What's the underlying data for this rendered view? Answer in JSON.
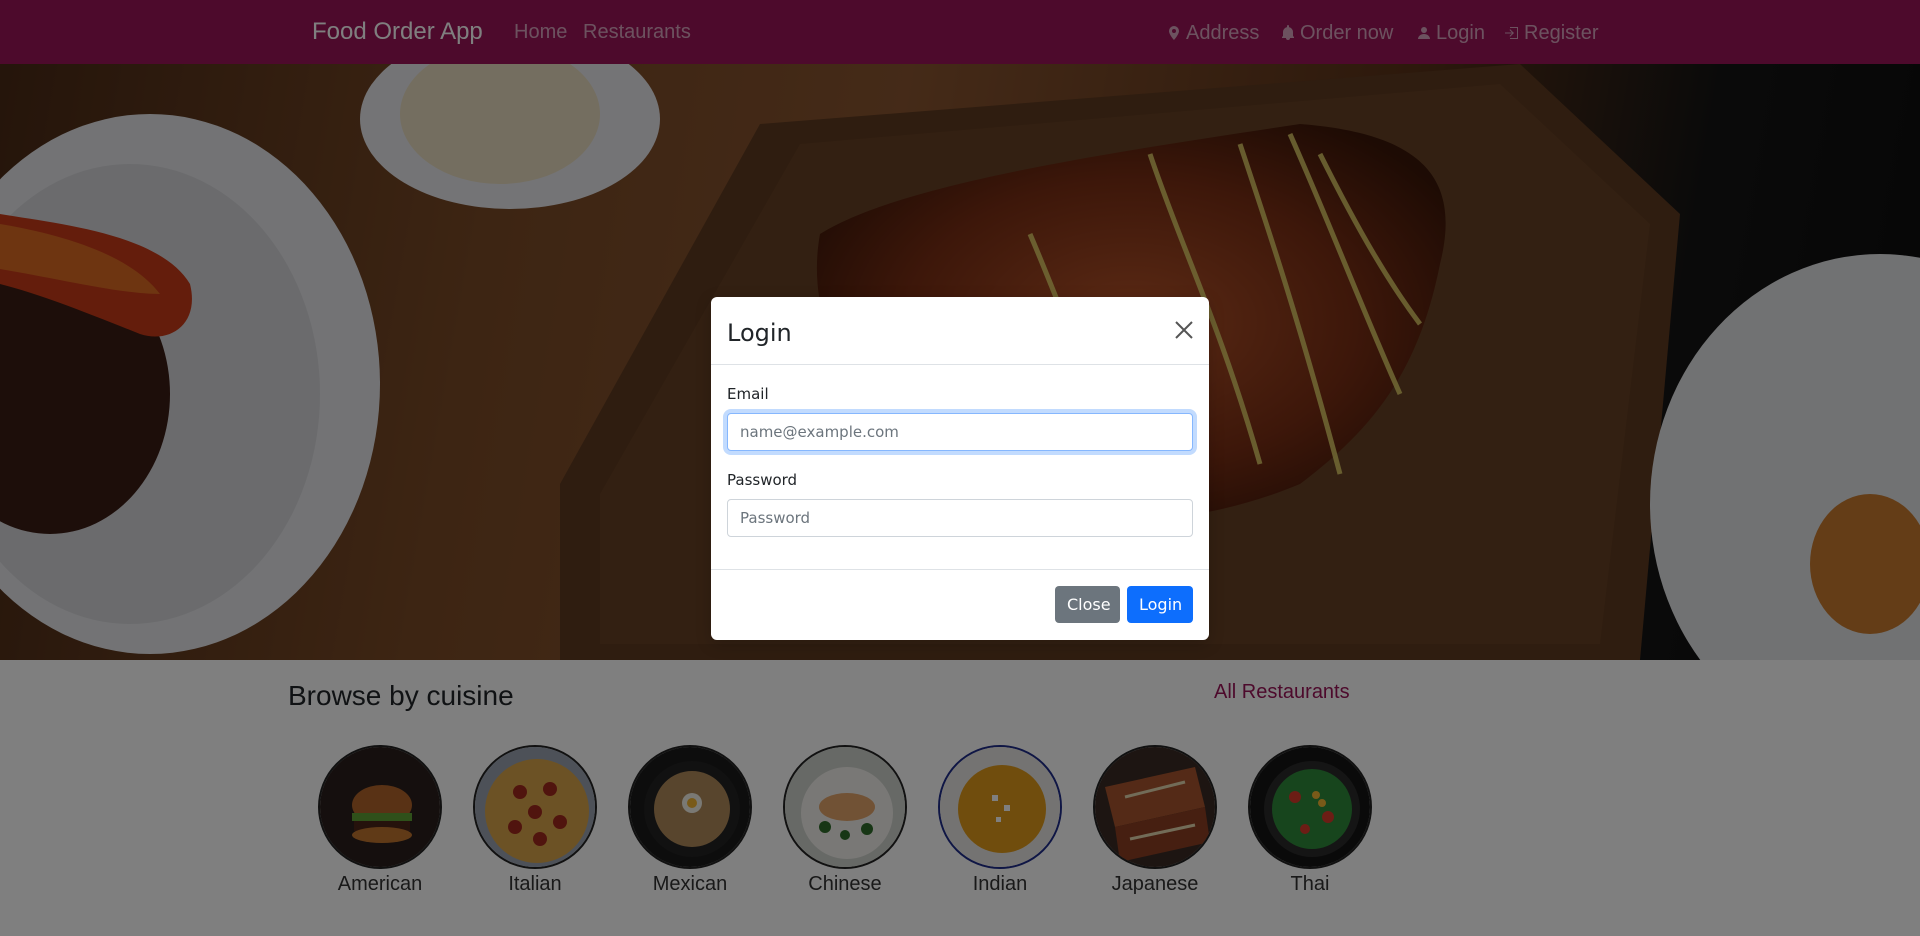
{
  "navbar": {
    "brand": "Food Order App",
    "links": {
      "home": "Home",
      "restaurants": "Restaurants"
    },
    "right": {
      "address": "Address",
      "order_now": "Order now",
      "login": "Login",
      "register": "Register"
    },
    "icons": {
      "address": "map-pin-icon",
      "order_now": "bell-icon",
      "login": "person-icon",
      "register": "sign-in-icon"
    },
    "background_color": "#9b1458"
  },
  "hero": {
    "image": "grilled-food-on-wooden-board"
  },
  "cuisine_section": {
    "title": "Browse by cuisine",
    "all_link": "All Restaurants",
    "items": [
      {
        "label": "American",
        "image": "burger"
      },
      {
        "label": "Italian",
        "image": "pepperoni-pizza"
      },
      {
        "label": "Mexican",
        "image": "noodle-bowl"
      },
      {
        "label": "Chinese",
        "image": "fish-dish"
      },
      {
        "label": "Indian",
        "image": "curry-soup"
      },
      {
        "label": "Japanese",
        "image": "sliced-pizza"
      },
      {
        "label": "Thai",
        "image": "salad-bowl"
      }
    ]
  },
  "login_modal": {
    "title": "Login",
    "email": {
      "label": "Email",
      "placeholder": "name@example.com",
      "value": ""
    },
    "password": {
      "label": "Password",
      "placeholder": "Password",
      "value": ""
    },
    "buttons": {
      "close": "Close",
      "login": "Login"
    },
    "colors": {
      "close_button": "#6c757d",
      "login_button": "#0d6efd"
    }
  }
}
